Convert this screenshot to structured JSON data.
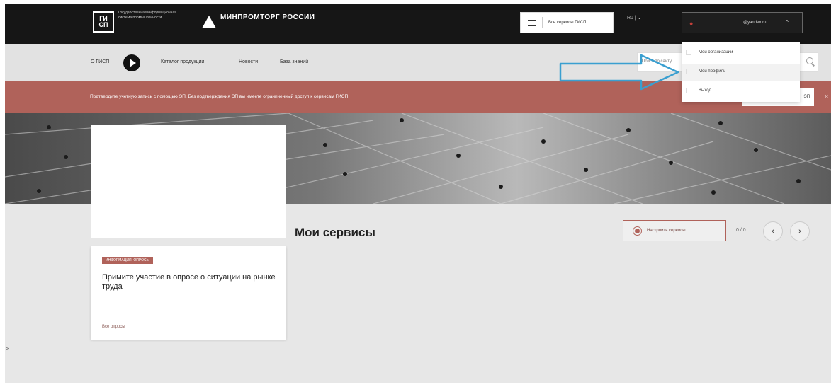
{
  "header": {
    "gisp_logo": "ГИ СП",
    "gisp_text": "Государственная информационная система промышленности",
    "ministry": "МИНПРОМТОРГ РОССИИ",
    "services_button": "Все сервисы ГИСП",
    "language": "Ru | ⌄",
    "user_email": "@yandex.ru",
    "user_chevron": "^"
  },
  "nav": {
    "items": [
      "О ГИСП",
      "Каталог продукции",
      "Новости",
      "База знаний"
    ],
    "search_placeholder": "Поиск по сайту"
  },
  "alert": {
    "text": "Подтвердите учетную запись с помощью ЭП. Без подтверждения ЭП вы имеете ограниченный доступ к сервисам ГИСП",
    "button": "ЭП",
    "close": "×"
  },
  "news": {
    "tag": "ИНФОРМАЦИЯ, ОПРОСЫ",
    "title": "Примите участие в опросе о ситуации на рынке труда",
    "link": "Все опросы"
  },
  "services": {
    "title": "Мои сервисы",
    "setup_button": "Настроить сервисы",
    "pager": "0 / 0",
    "prev": "‹",
    "next": "›"
  },
  "side_mark": ">",
  "dropdown": {
    "items": [
      "Мои организации",
      "Мой профиль",
      "Выход"
    ],
    "highlighted_index": 1
  },
  "colors": {
    "accent": "#b0625a",
    "arrow": "#3a9fd0",
    "topbar": "#161616"
  }
}
